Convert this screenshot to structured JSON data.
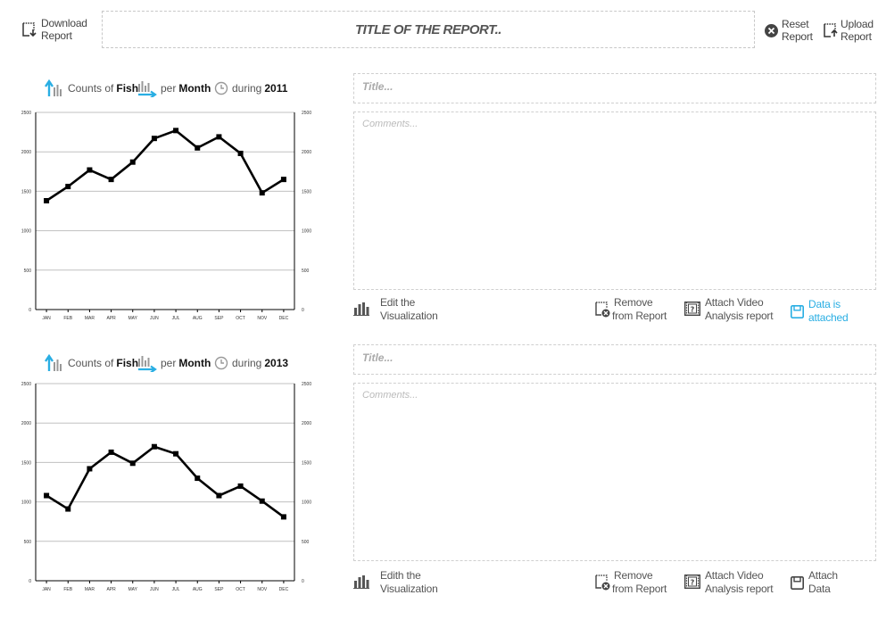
{
  "header": {
    "download": {
      "line1": "Download",
      "line2": "Report"
    },
    "title": "TITLE OF THE REPORT..",
    "reset": {
      "line1": "Reset",
      "line2": "Report"
    },
    "upload": {
      "line1": "Upload",
      "line2": "Report"
    }
  },
  "colors": {
    "accent": "#29aee3",
    "line": "#000000",
    "grid": "#c0c0c0"
  },
  "panels": [
    {
      "header": {
        "counts": "Counts of",
        "subject": "Fish",
        "per": "per",
        "period": "Month",
        "during": "during",
        "year": "2011"
      },
      "title_placeholder": "Title...",
      "comments_placeholder": "Comments...",
      "actions": {
        "edit": {
          "line1": "Edit the",
          "line2": "Visualization"
        },
        "remove": {
          "line1": "Remove",
          "line2": "from Report"
        },
        "video": {
          "line1": "Attach Video",
          "line2": "Analysis report"
        },
        "data": {
          "line1": "Data is",
          "line2": "attached",
          "state": "attached"
        }
      }
    },
    {
      "header": {
        "counts": "Counts of",
        "subject": "Fish",
        "per": "per",
        "period": "Month",
        "during": "during",
        "year": "2013"
      },
      "title_placeholder": "Title...",
      "comments_placeholder": "Comments...",
      "actions": {
        "edit": {
          "line1": "Edith the",
          "line2": "Visualization"
        },
        "remove": {
          "line1": "Remove",
          "line2": "from Report"
        },
        "video": {
          "line1": "Attach Video",
          "line2": "Analysis report"
        },
        "data": {
          "line1": "Attach",
          "line2": "Data",
          "state": "not-attached"
        }
      }
    }
  ],
  "chart_data": [
    {
      "type": "line",
      "categories": [
        "JAN",
        "FEB",
        "MAR",
        "APR",
        "MAY",
        "JUN",
        "JUL",
        "AUG",
        "SEP",
        "OCT",
        "NOV",
        "DEC"
      ],
      "values": [
        1380,
        1560,
        1770,
        1650,
        1870,
        2170,
        2270,
        2050,
        2190,
        1980,
        1480,
        1650
      ],
      "ylim": [
        0,
        2500
      ],
      "yticks": [
        0,
        500,
        1000,
        1500,
        2000,
        2500
      ],
      "grid": true,
      "right_axis": true
    },
    {
      "type": "line",
      "categories": [
        "JAN",
        "FEB",
        "MAR",
        "APR",
        "MAY",
        "JUN",
        "JUL",
        "AUG",
        "SEP",
        "OCT",
        "NOV",
        "DEC"
      ],
      "values": [
        1080,
        910,
        1420,
        1630,
        1490,
        1700,
        1610,
        1300,
        1080,
        1200,
        1010,
        810
      ],
      "ylim": [
        0,
        2500
      ],
      "yticks": [
        0,
        500,
        1000,
        1500,
        2000,
        2500
      ],
      "grid": true,
      "right_axis": true
    }
  ]
}
